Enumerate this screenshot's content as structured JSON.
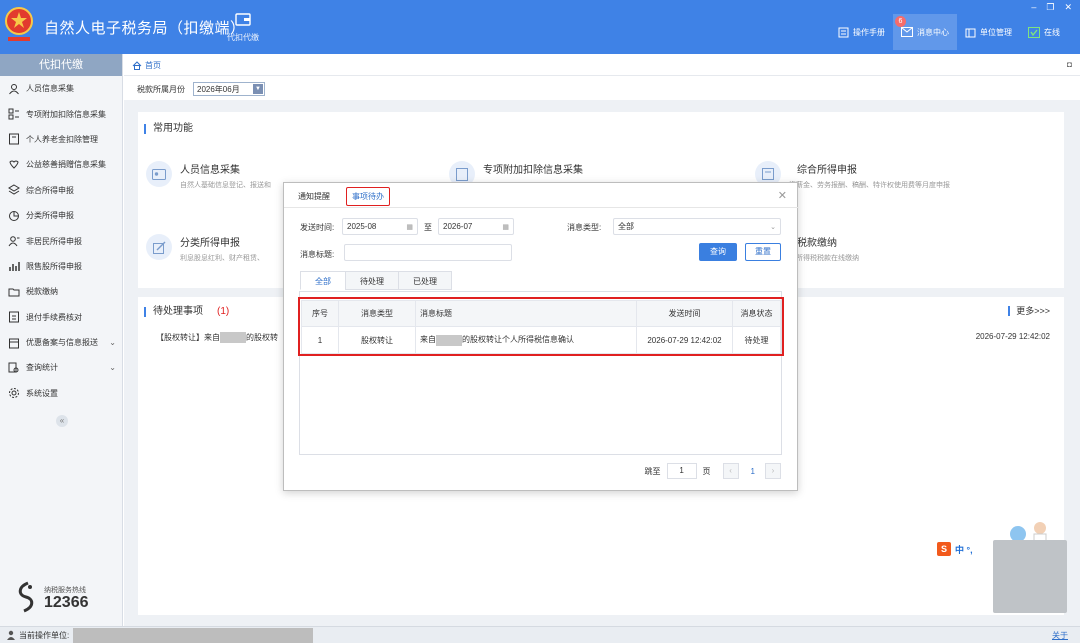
{
  "header": {
    "app_title": "自然人电子税务局（扣缴端）",
    "module_label": "代扣代缴",
    "manual": "操作手册",
    "message_center": "消息中心",
    "message_count": "6",
    "unit_mgmt": "单位管理",
    "online": "在线"
  },
  "sidebar": {
    "title": "代扣代缴",
    "items": [
      {
        "label": "人员信息采集",
        "icon": "person-icon"
      },
      {
        "label": "专项附加扣除信息采集",
        "icon": "grid-list-icon"
      },
      {
        "label": "个人养老金扣除管理",
        "icon": "document-icon"
      },
      {
        "label": "公益慈善捐赠信息采集",
        "icon": "donation-icon"
      },
      {
        "label": "综合所得申报",
        "icon": "layers-icon"
      },
      {
        "label": "分类所得申报",
        "icon": "pie-icon"
      },
      {
        "label": "非居民所得申报",
        "icon": "person-plus-icon"
      },
      {
        "label": "限售股所得申报",
        "icon": "bar-chart-icon"
      },
      {
        "label": "税款缴纳",
        "icon": "folder-icon"
      },
      {
        "label": "退付手续费核对",
        "icon": "checklist-icon"
      },
      {
        "label": "优惠备案与信息报送",
        "icon": "box-icon"
      },
      {
        "label": "查询统计",
        "icon": "search-icon"
      },
      {
        "label": "系统设置",
        "icon": "gear-icon"
      }
    ],
    "hotline_label": "纳税服务热线",
    "hotline_number": "12366"
  },
  "breadcrumb": {
    "home": "首页"
  },
  "tax_month": {
    "label": "税款所属月份",
    "value": "2026年06月"
  },
  "common_functions": {
    "title": "常用功能",
    "items": [
      {
        "name": "人员信息采集",
        "desc": "自然人基础信息登记、报送和"
      },
      {
        "name": "专项附加扣除信息采集",
        "desc": ""
      },
      {
        "name": "综合所得申报",
        "desc": "资薪金、劳务报酬、稿酬、特许权使用费等月度申报"
      },
      {
        "name": "分类所得申报",
        "desc": "利息股息红利、财产租赁、"
      },
      {
        "name": "税款缴纳",
        "desc": "人所得税税款在线缴纳"
      }
    ]
  },
  "pending": {
    "title": "待处理事项",
    "count": "(1)",
    "more": "更多>>>",
    "row_prefix": "【股权转让】来自",
    "row_suffix": "的股权转",
    "row_time": "2026-07-29 12:42:02"
  },
  "dialog": {
    "tab_notice": "通知提醒",
    "tab_todo": "事项待办",
    "send_time_label": "发送时间:",
    "date_from": "2025-08",
    "date_to_label": "至",
    "date_to": "2026-07",
    "msg_type_label": "消息类型:",
    "msg_type_value": "全部",
    "msg_title_label": "消息标题:",
    "msg_title_value": "",
    "query_btn": "查询",
    "reset_btn": "重置",
    "subtabs": [
      "全部",
      "待处理",
      "已处理"
    ],
    "columns": [
      "序号",
      "消息类型",
      "消息标题",
      "发送时间",
      "消息状态"
    ],
    "rows": [
      {
        "no": "1",
        "type": "股权转让",
        "title_prefix": "来自",
        "title_suffix": "的股权转让个人所得税信息确认",
        "time": "2026-07-29 12:42:02",
        "status": "待处理"
      }
    ],
    "pager_jump": "跳至",
    "pager_page_value": "1",
    "pager_page_unit": "页",
    "pager_current": "1"
  },
  "statusbar": {
    "label": "当前操作单位:",
    "about": "关于"
  },
  "ime": {
    "s": "S",
    "text": "中 °,"
  }
}
